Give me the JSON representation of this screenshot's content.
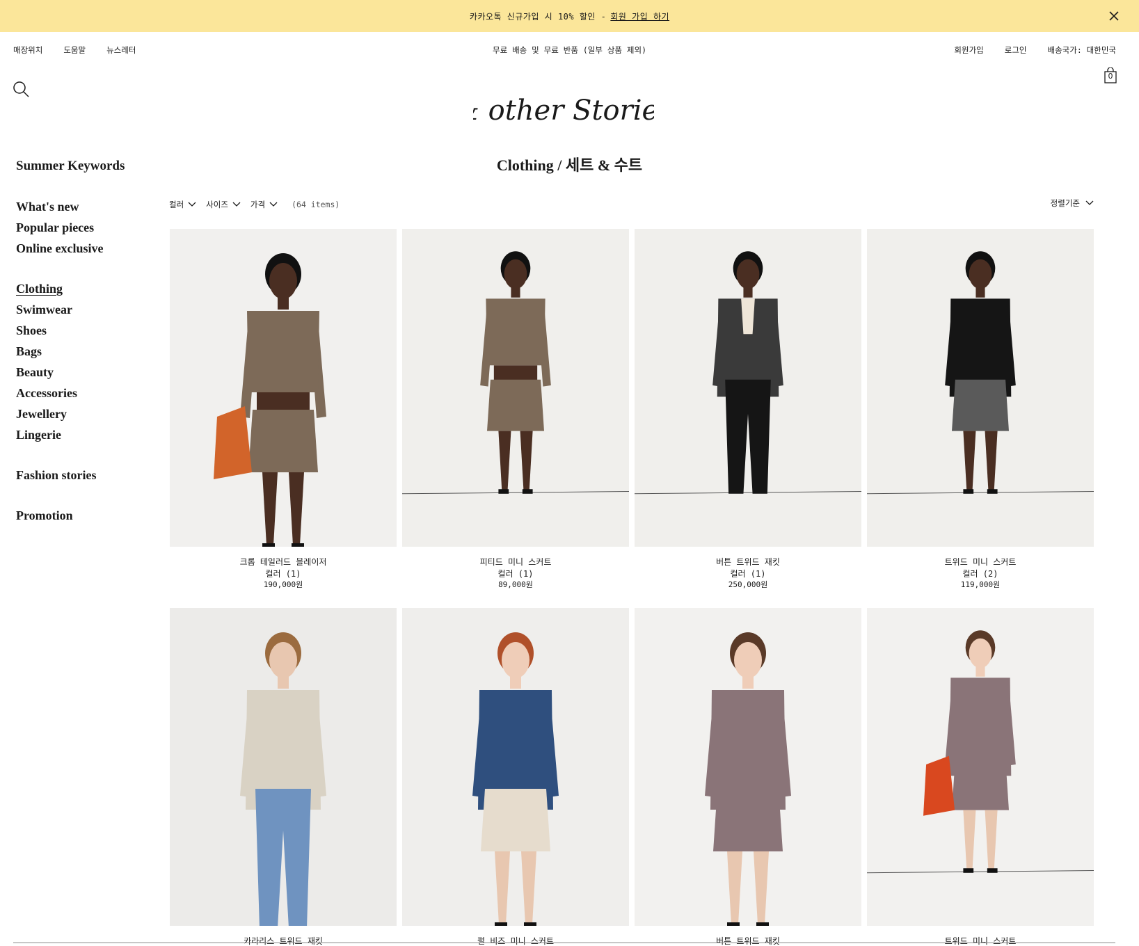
{
  "promo": {
    "text": "카카오톡 신규가입 시 10% 할인 -",
    "link": "회원 가입 하기"
  },
  "topbar": {
    "left": [
      "매장위치",
      "도움말",
      "뉴스레터"
    ],
    "center": "무료 배송 및 무료 반품 (일부 상품 제외)",
    "right": [
      "회원가입",
      "로그인",
      "배송국가: 대한민국"
    ]
  },
  "bag_count": "0",
  "logo_text": "& other Stories",
  "sidebar": {
    "groups": [
      [
        "Summer Keywords"
      ],
      [
        "What's new",
        "Popular pieces",
        "Online exclusive"
      ],
      [
        "Clothing",
        "Swimwear",
        "Shoes",
        "Bags",
        "Beauty",
        "Accessories",
        "Jewellery",
        "Lingerie"
      ],
      [
        "Fashion stories"
      ],
      [
        "Promotion"
      ]
    ],
    "active": "Clothing"
  },
  "page_title": {
    "prefix": "Clothing /",
    "category": "세트 & 수트"
  },
  "filters": {
    "color": "컬러",
    "size": "사이즈",
    "price": "가격",
    "count": "(64 items)",
    "sort": "정렬기준"
  },
  "products": [
    {
      "name": "크롭 테일러드 블레이저",
      "colors": "컬러 (1)",
      "price": "190,000원",
      "style": "brown-suit"
    },
    {
      "name": "피티드 미니 스커트",
      "colors": "컬러 (1)",
      "price": "89,000원",
      "style": "brown-suit-full"
    },
    {
      "name": "버튼 트위드 재킷",
      "colors": "컬러 (1)",
      "price": "250,000원",
      "style": "houndstooth-jacket"
    },
    {
      "name": "트위드 미니 스커트",
      "colors": "컬러 (2)",
      "price": "119,000원",
      "style": "houndstooth-skirt"
    },
    {
      "name": "카라리스 트위드 재킷",
      "colors": "",
      "price": "",
      "style": "cream-jacket"
    },
    {
      "name": "펄 비즈 미니 스커트",
      "colors": "",
      "price": "",
      "style": "denim-skirt"
    },
    {
      "name": "버튼 트위드 재킷",
      "colors": "",
      "price": "",
      "style": "plaid-jacket"
    },
    {
      "name": "트위드 미니 스커트",
      "colors": "",
      "price": "",
      "style": "plaid-full"
    }
  ]
}
